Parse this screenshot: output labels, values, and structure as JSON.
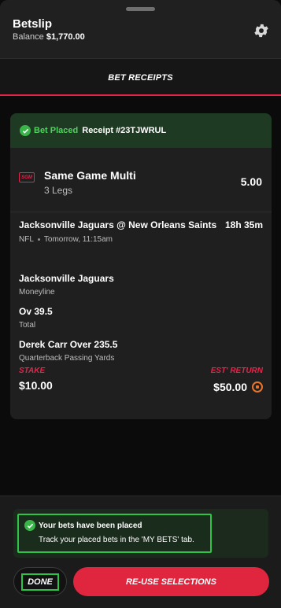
{
  "header": {
    "title": "Betslip",
    "balance_label": "Balance",
    "balance_value": "$1,770.00",
    "settings_icon": "gear-icon"
  },
  "tabs": [
    {
      "label": "BET RECEIPTS",
      "active": true
    }
  ],
  "receipt": {
    "status": "Bet Placed",
    "receipt_id": "Receipt #23TJWRUL",
    "bet_type": "Same Game Multi",
    "bet_type_badge": "SGM",
    "legs_count": "3 Legs",
    "odds": "5.00",
    "game": {
      "name": "Jacksonville Jaguars @ New Orleans Saints",
      "countdown": "18h 35m",
      "league": "NFL",
      "start": "Tomorrow, 11:15am"
    },
    "legs": [
      {
        "selection": "Jacksonville Jaguars",
        "market": "Moneyline"
      },
      {
        "selection": "Ov 39.5",
        "market": "Total"
      },
      {
        "selection": "Derek Carr Over 235.5",
        "market": "Quarterback Passing Yards"
      }
    ],
    "stake_label": "STAKE",
    "stake_value": "$10.00",
    "return_label": "EST' RETURN",
    "return_value": "$50.00"
  },
  "notice": {
    "line1": "Your bets have been placed",
    "line2": "Track your placed bets in the 'MY BETS' tab."
  },
  "actions": {
    "done": "DONE",
    "reuse": "RE-USE SELECTIONS"
  },
  "colors": {
    "accent": "#e3254a",
    "success": "#3ab54a",
    "background": "#0b0b0b"
  }
}
